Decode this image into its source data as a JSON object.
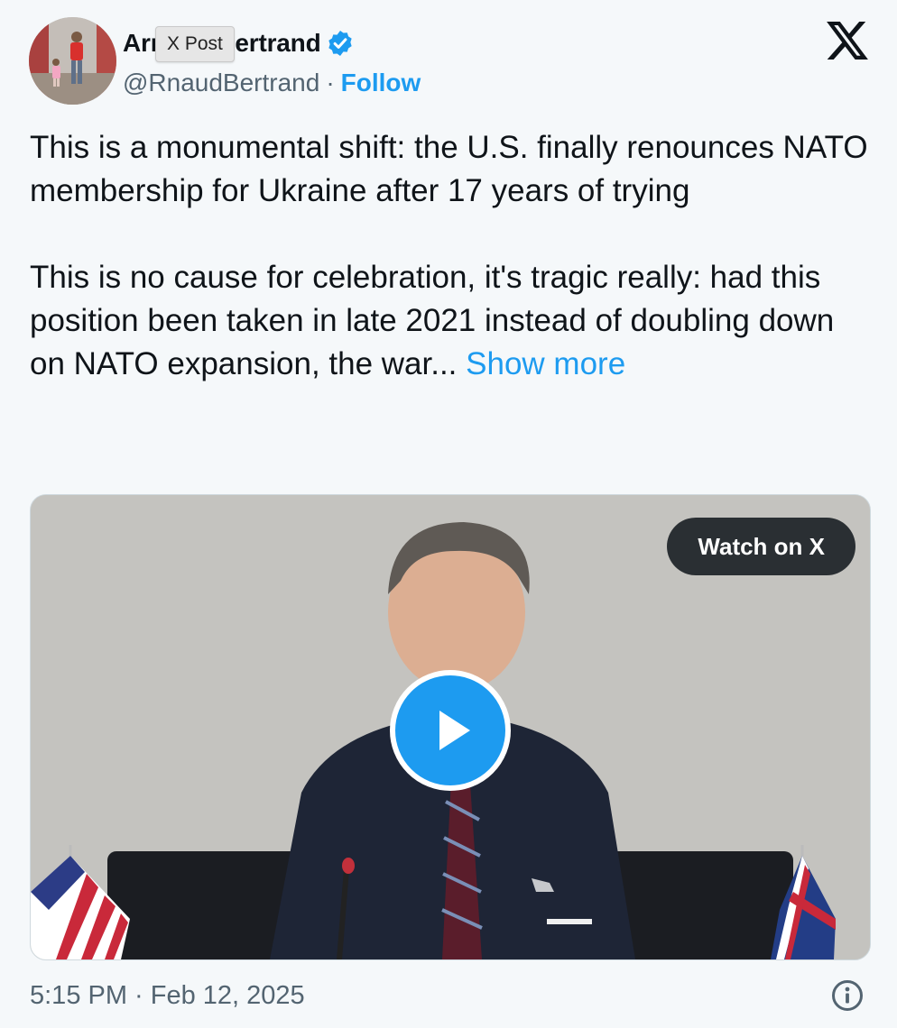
{
  "author": {
    "display_name": "Arnaud Bertrand",
    "handle": "@RnaudBertrand",
    "separator": "·",
    "follow_label": "Follow",
    "verified_color": "#1d9bf0"
  },
  "tooltip": {
    "label": "X Post"
  },
  "tweet": {
    "paragraph_1": "This is a monumental shift: the U.S. finally renounces NATO membership for Ukraine after 17 years of trying",
    "paragraph_2": "This is no cause for celebration, it's tragic really: had this position been taken in late 2021 instead of doubling down on NATO expansion, the war... ",
    "show_more_label": "Show more"
  },
  "media": {
    "watch_label": "Watch on X",
    "play_icon": "play-icon"
  },
  "meta": {
    "timestamp": "5:15 PM · Feb 12, 2025"
  },
  "colors": {
    "accent": "#1d9bf0",
    "text": "#0f1419",
    "muted": "#536471",
    "background": "#f5f8fa"
  }
}
